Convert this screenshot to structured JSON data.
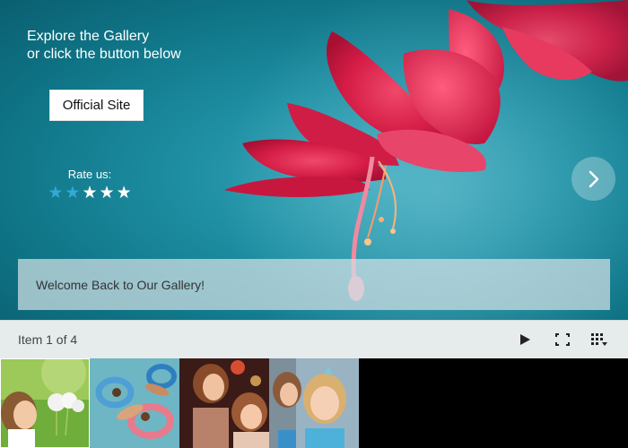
{
  "hero": {
    "caption_line1": "Explore the Gallery",
    "caption_line2": "or click the button below",
    "button_label": "Official Site",
    "rate_label": "Rate us:",
    "rating": 2,
    "rating_max": 5,
    "star_glyph": "★",
    "star_on_color": "#33a9d6",
    "welcome_text": "Welcome Back to Our Gallery!"
  },
  "toolbar": {
    "counter": "Item 1 of 4",
    "icons": [
      "play-icon",
      "fullscreen-icon",
      "thumbnails-grid-icon"
    ]
  },
  "thumbnails": [
    {
      "name": "thumbnail-dandelion-girl",
      "selected": true
    },
    {
      "name": "thumbnail-pool-floats",
      "selected": false
    },
    {
      "name": "thumbnail-party-girls",
      "selected": false
    },
    {
      "name": "thumbnail-smiling-girl",
      "selected": false
    }
  ]
}
